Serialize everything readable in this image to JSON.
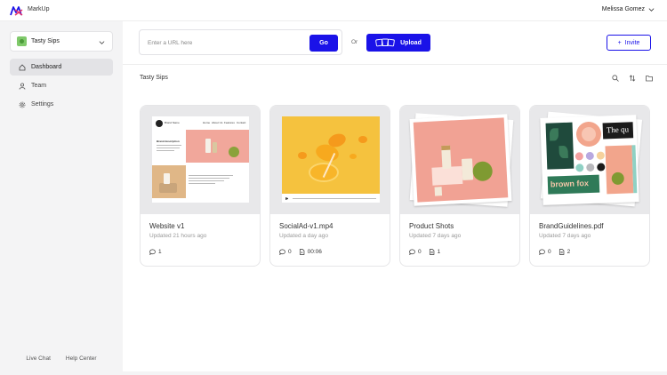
{
  "app": {
    "name": "MarkUp",
    "user_name": "Melissa Gomez",
    "accent": "#1a12e8"
  },
  "sidebar": {
    "workspace": "Tasty Sips",
    "items": [
      {
        "label": "Dashboard",
        "icon": "home-icon",
        "active": true
      },
      {
        "label": "Team",
        "icon": "person-icon",
        "active": false
      },
      {
        "label": "Settings",
        "icon": "gear-icon",
        "active": false
      }
    ],
    "footer": {
      "live_chat": "Live Chat",
      "help_center": "Help Center"
    }
  },
  "toolbar": {
    "url_placeholder": "Enter a URL here",
    "url_value": "",
    "go_label": "Go",
    "or_label": "Or",
    "upload_label": "Upload",
    "invite_label": "Invite"
  },
  "project": {
    "title": "Tasty Sips"
  },
  "cards": [
    {
      "title": "Website v1",
      "updated": "Updated 21 hours ago",
      "comments": "1"
    },
    {
      "title": "SocialAd-v1.mp4",
      "updated": "Updated a day ago",
      "comments": "0",
      "duration": "00:06"
    },
    {
      "title": "Product Shots",
      "updated": "Updated 7 days ago",
      "comments": "0",
      "files": "1"
    },
    {
      "title": "BrandGuidelines.pdf",
      "updated": "Updated 7 days ago",
      "comments": "0",
      "files": "2"
    }
  ],
  "thumbs": {
    "website": {
      "brand": "Brand Name",
      "nav": [
        "Home",
        "About Us",
        "Features",
        "Contact"
      ],
      "heading": "Brand description"
    },
    "brand": {
      "headline": "The qu",
      "tagline": "brown fox"
    }
  }
}
